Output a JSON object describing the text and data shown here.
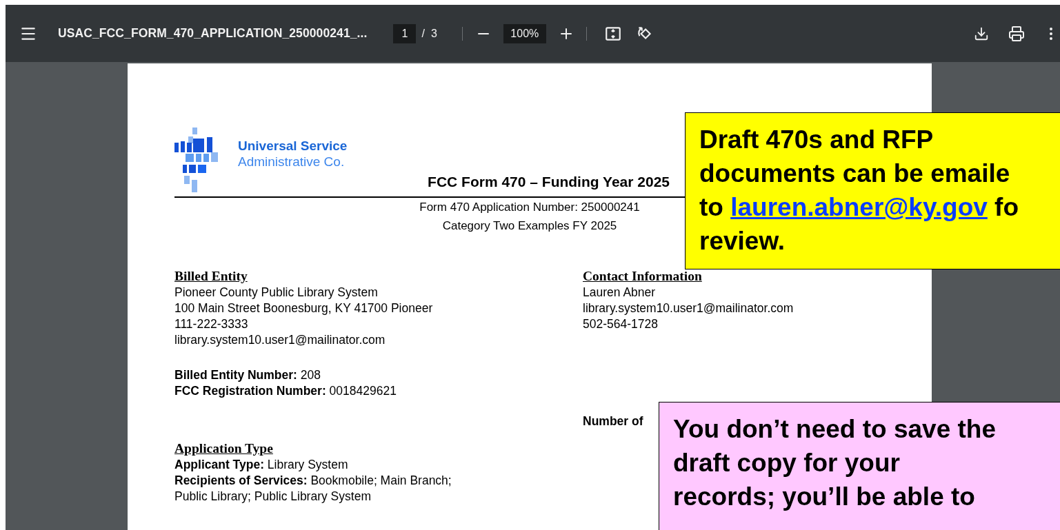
{
  "toolbar": {
    "title": "USAC_FCC_FORM_470_APPLICATION_250000241_...",
    "page": {
      "current": "1",
      "separator": "/",
      "total": "3"
    },
    "zoom": "100%"
  },
  "document": {
    "logo": {
      "line_1": "Universal Service",
      "line_2": "Administrative Co."
    },
    "title": "FCC Form 470 – Funding Year 2025",
    "subtitles": [
      "Form 470 Application Number: 250000241",
      "Category Two Examples FY 2025"
    ],
    "left_column": [
      {
        "heading": "Billed Entity",
        "lines": [
          "Pioneer County Public Library System",
          "100 Main Street Boonesburg, KY 41700 Pioneer",
          "111-222-3333",
          "library.system10.user1@mailinator.com"
        ]
      },
      {
        "lines": [
          "**Billed Entity Number:** 208",
          "**FCC Registration Number:** 0018429621"
        ]
      },
      {
        "heading": "Application Type",
        "lines": [
          "**Applicant Type:** Library System",
          "**Recipients of Services:** Bookmobile; Main Branch; Public Library; Public Library System"
        ]
      }
    ],
    "right_column": [
      {
        "heading": "Contact Information",
        "lines": [
          "Lauren Abner",
          "library.system10.user1@mailinator.com",
          "502-564-1728"
        ]
      },
      {
        "label": "Number of"
      }
    ]
  },
  "callouts": [
    {
      "color": "#ffff00",
      "lines": [
        [
          {
            "text": "Draft 470s and RFP"
          }
        ],
        [
          {
            "text": "documents can be emaile"
          }
        ],
        [
          {
            "text": "to "
          },
          {
            "text": "lauren.abner@ky.gov",
            "link": true
          },
          {
            "text": " fo"
          }
        ],
        [
          {
            "text": "review."
          }
        ]
      ]
    },
    {
      "color": "#ffc8ff",
      "lines": [
        [
          {
            "text": "You don’t need to save the"
          }
        ],
        [
          {
            "text": "draft copy for your"
          }
        ],
        [
          {
            "text": "records; you’ll be able to"
          }
        ]
      ]
    }
  ]
}
